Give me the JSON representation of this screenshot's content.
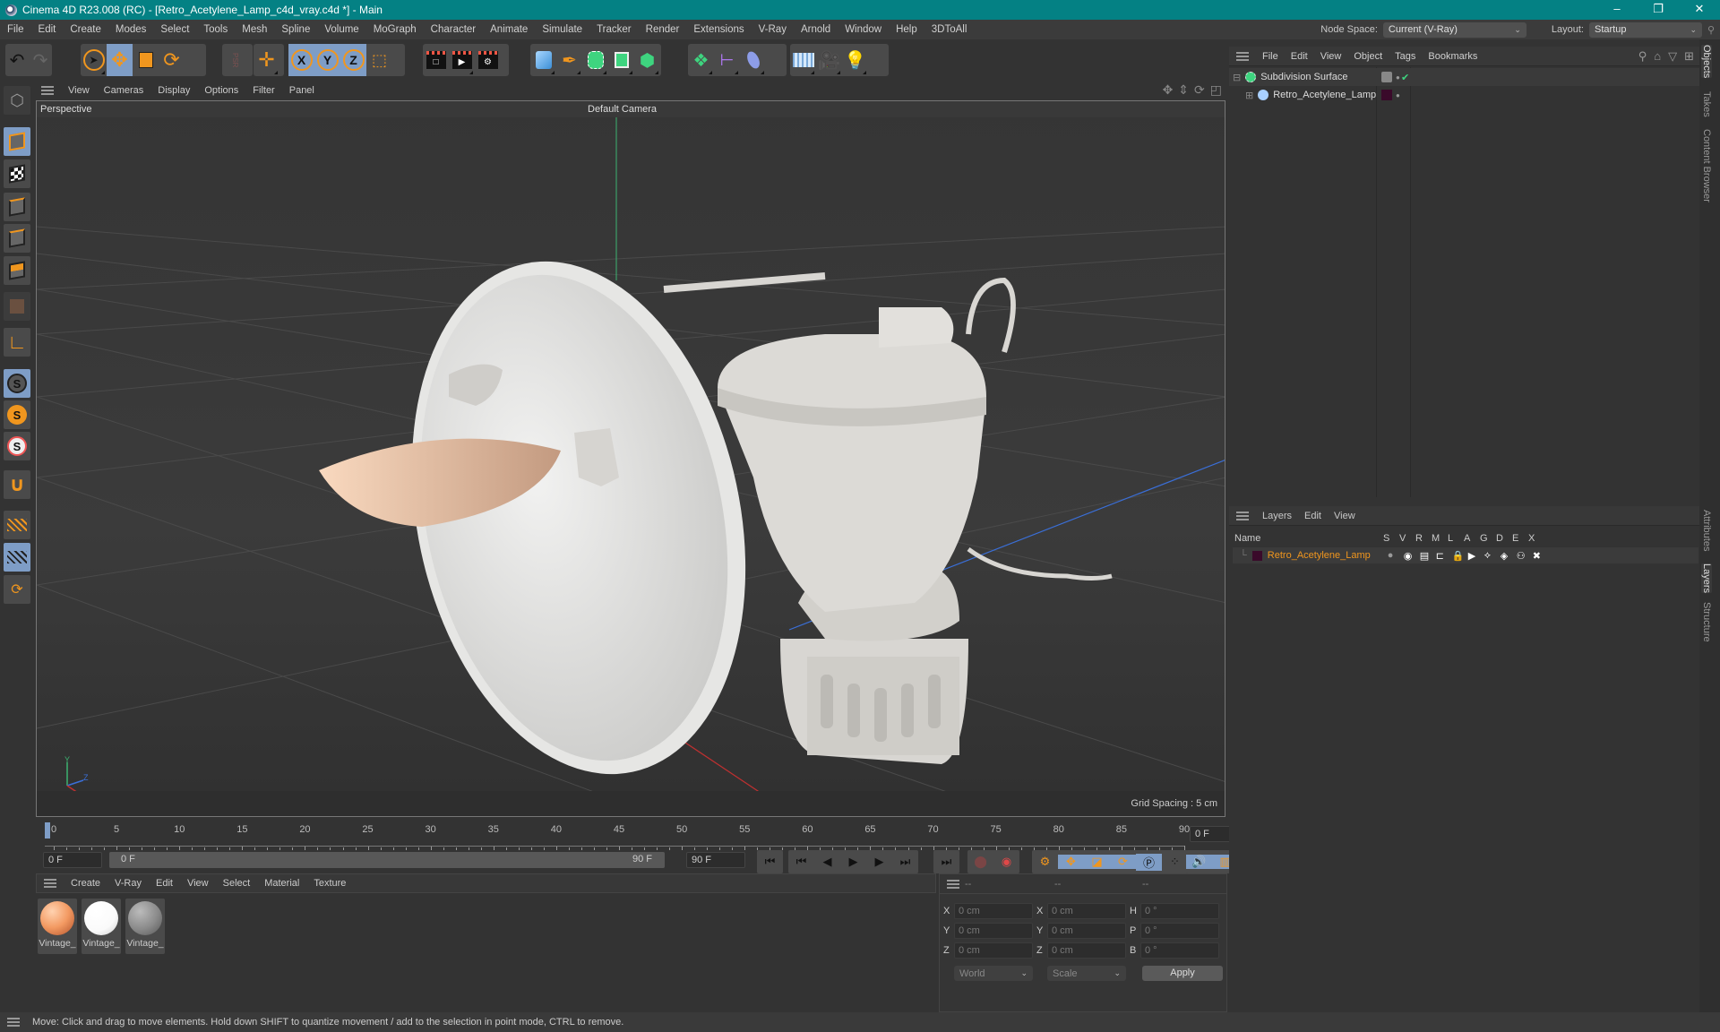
{
  "window": {
    "title": "Cinema 4D R23.008 (RC) - [Retro_Acetylene_Lamp_c4d_vray.c4d *] - Main",
    "minimize": "–",
    "restore": "❐",
    "close": "✕"
  },
  "menubar": {
    "items": [
      "File",
      "Edit",
      "Create",
      "Modes",
      "Select",
      "Tools",
      "Mesh",
      "Spline",
      "Volume",
      "MoGraph",
      "Character",
      "Animate",
      "Simulate",
      "Tracker",
      "Render",
      "Extensions",
      "V-Ray",
      "Arnold",
      "Window",
      "Help",
      "3DToAll"
    ],
    "node_space_label": "Node Space:",
    "node_space_value": "Current (V-Ray)",
    "layout_label": "Layout:",
    "layout_value": "Startup"
  },
  "toolbar": {
    "axis_x": "X",
    "axis_y": "Y",
    "axis_z": "Z",
    "psr": "PSR"
  },
  "viewport": {
    "menu": [
      "View",
      "Cameras",
      "Display",
      "Options",
      "Filter",
      "Panel"
    ],
    "view_name": "Perspective",
    "camera": "Default Camera",
    "grid_spacing": "Grid Spacing : 5 cm",
    "axis_x": "X",
    "axis_y": "Y",
    "axis_z": "Z"
  },
  "timeline": {
    "labels": [
      "0",
      "5",
      "10",
      "15",
      "20",
      "25",
      "30",
      "35",
      "40",
      "45",
      "50",
      "55",
      "60",
      "65",
      "70",
      "75",
      "80",
      "85",
      "90"
    ],
    "current_frame": "0 F",
    "start_field": "0 F",
    "range_start": "0 F",
    "range_end": "90 F",
    "end_field": "90 F"
  },
  "materials": {
    "menu": [
      "Create",
      "V-Ray",
      "Edit",
      "View",
      "Select",
      "Material",
      "Texture"
    ],
    "items": [
      {
        "label": "Vintage_",
        "color": "#f39a62"
      },
      {
        "label": "Vintage_",
        "color": "#ffffff"
      },
      {
        "label": "Vintage_",
        "color": "#8a8a8a"
      }
    ]
  },
  "coordinates": {
    "headers": [
      "--",
      "--",
      "--"
    ],
    "rows": [
      {
        "l1": "X",
        "v1": "0 cm",
        "l2": "X",
        "v2": "0 cm",
        "l3": "H",
        "v3": "0 °"
      },
      {
        "l1": "Y",
        "v1": "0 cm",
        "l2": "Y",
        "v2": "0 cm",
        "l3": "P",
        "v3": "0 °"
      },
      {
        "l1": "Z",
        "v1": "0 cm",
        "l2": "Z",
        "v2": "0 cm",
        "l3": "B",
        "v3": "0 °"
      }
    ],
    "mode": "World",
    "transform": "Scale",
    "apply": "Apply"
  },
  "objects": {
    "menu": [
      "File",
      "Edit",
      "View",
      "Object",
      "Tags",
      "Bookmarks"
    ],
    "items": [
      {
        "name": "Subdivision Surface",
        "color": ""
      },
      {
        "name": "Retro_Acetylene_Lamp",
        "color": "#3a0a2a"
      }
    ]
  },
  "layers": {
    "menu": [
      "Layers",
      "Edit",
      "View"
    ],
    "columns": [
      "Name",
      "S",
      "V",
      "R",
      "M",
      "L",
      "A",
      "G",
      "D",
      "E",
      "X"
    ],
    "items": [
      {
        "name": "Retro_Acetylene_Lamp",
        "color": "#3a0a2a",
        "text_color": "#f0961e"
      }
    ]
  },
  "side_tabs": {
    "top": [
      "Objects",
      "Takes",
      "Content Browser"
    ],
    "bottom": [
      "Attributes",
      "Layers",
      "Structure"
    ]
  },
  "status": {
    "message": "Move: Click and drag to move elements. Hold down SHIFT to quantize movement / add to the selection in point mode, CTRL to remove."
  },
  "colors": {
    "title_bar": "#048184",
    "accent_orange": "#f0961e",
    "active_blue": "#7e9dc6"
  }
}
